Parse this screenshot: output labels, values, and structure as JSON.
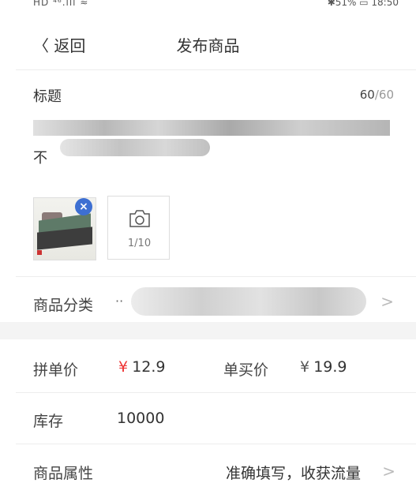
{
  "status_bar": {
    "left": "HD ⁴⁶.ıll ≈",
    "right": "✱51% ▭ 18:50"
  },
  "nav": {
    "back_label": "〈 返回",
    "title": "发布商品"
  },
  "title_field": {
    "label": "标题",
    "count_current": "60",
    "count_max": "/60",
    "visible_start": "不"
  },
  "photos": {
    "remove_icon": "×",
    "add_count": "1/10"
  },
  "category": {
    "label": "商品分类",
    "prefix": "··"
  },
  "group_price": {
    "label": "拼单价",
    "currency": "¥",
    "value": "12.9"
  },
  "single_price": {
    "label": "单买价",
    "currency": "¥",
    "value": "19.9"
  },
  "stock": {
    "label": "库存",
    "value": "10000"
  },
  "attributes": {
    "label": "商品属性",
    "hint": "准确填写，收获流量"
  },
  "icons": {
    "chevron_right": ">",
    "camera": "camera-icon"
  },
  "colors": {
    "price_red": "#ee3333",
    "close_blue": "#3d6fd2"
  }
}
